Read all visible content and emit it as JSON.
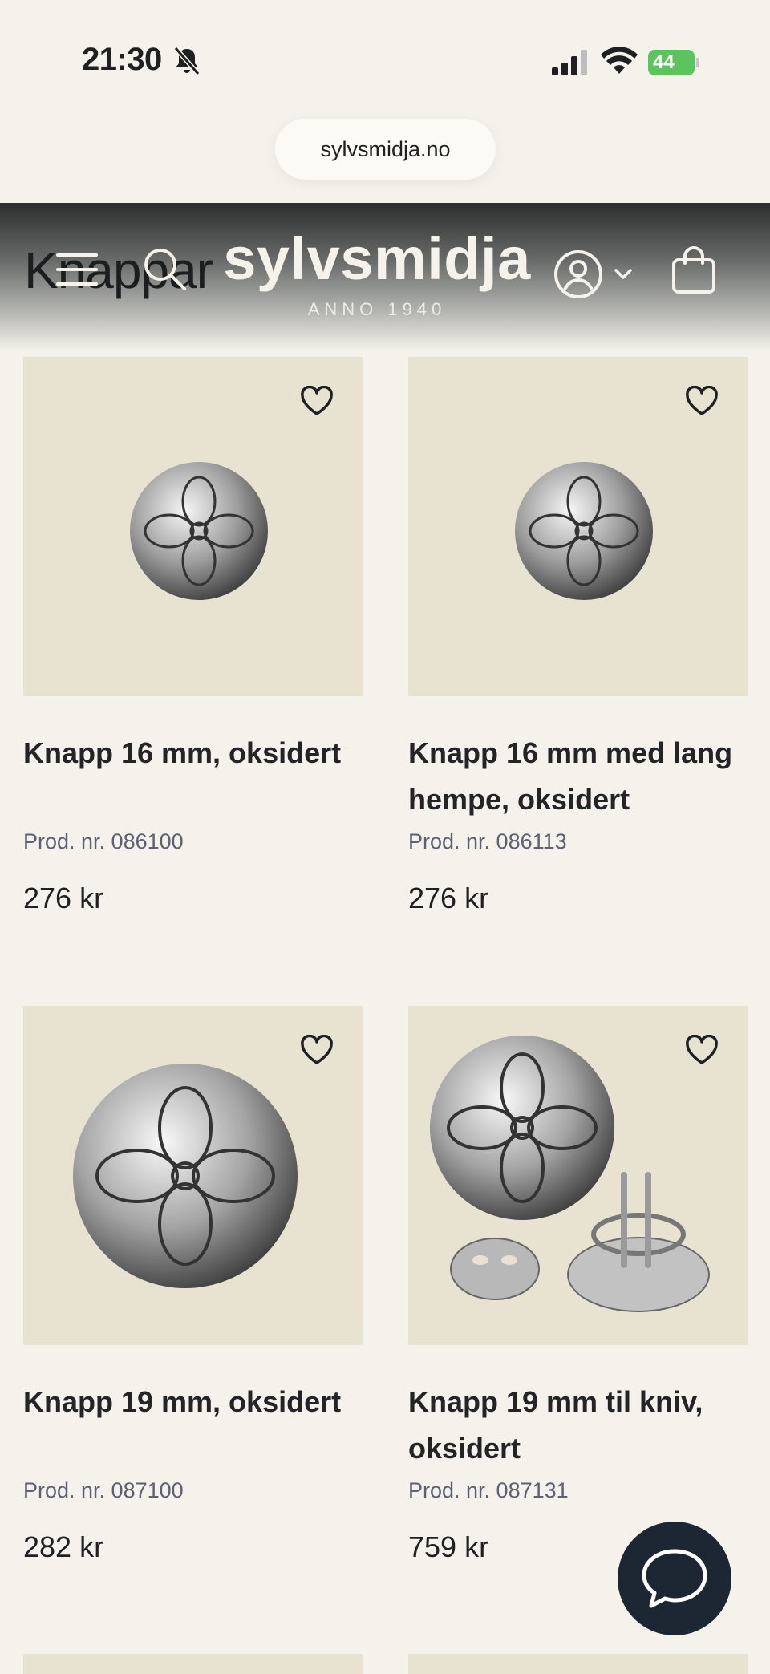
{
  "status_bar": {
    "time": "21:30",
    "battery": "44"
  },
  "browser": {
    "url": "sylvsmidja.no"
  },
  "header": {
    "logo": "sylvsmidja",
    "logo_sub": "ANNO 1940",
    "page_title": "Knappar"
  },
  "products": [
    {
      "name": "Knapp 16 mm, oksidert",
      "prod_nr": "Prod. nr. 086100",
      "price": "276 kr"
    },
    {
      "name": "Knapp 16 mm med lang hempe, oksidert",
      "prod_nr": "Prod. nr. 086113",
      "price": "276 kr"
    },
    {
      "name": "Knapp 19 mm, oksidert",
      "prod_nr": "Prod. nr. 087100",
      "price": "282 kr"
    },
    {
      "name": "Knapp 19 mm til kniv, oksidert",
      "prod_nr": "Prod. nr. 087131",
      "price": "759 kr"
    }
  ],
  "icons": {
    "menu": "menu-icon",
    "search": "search-icon",
    "account": "account-icon",
    "cart": "shopping-bag-icon",
    "favorite": "heart-icon",
    "chat": "chat-icon"
  },
  "colors": {
    "background": "#f4f2ea",
    "image_bg": "#e8e2d0",
    "chat": "#1d2633",
    "battery": "#5cc45e"
  }
}
